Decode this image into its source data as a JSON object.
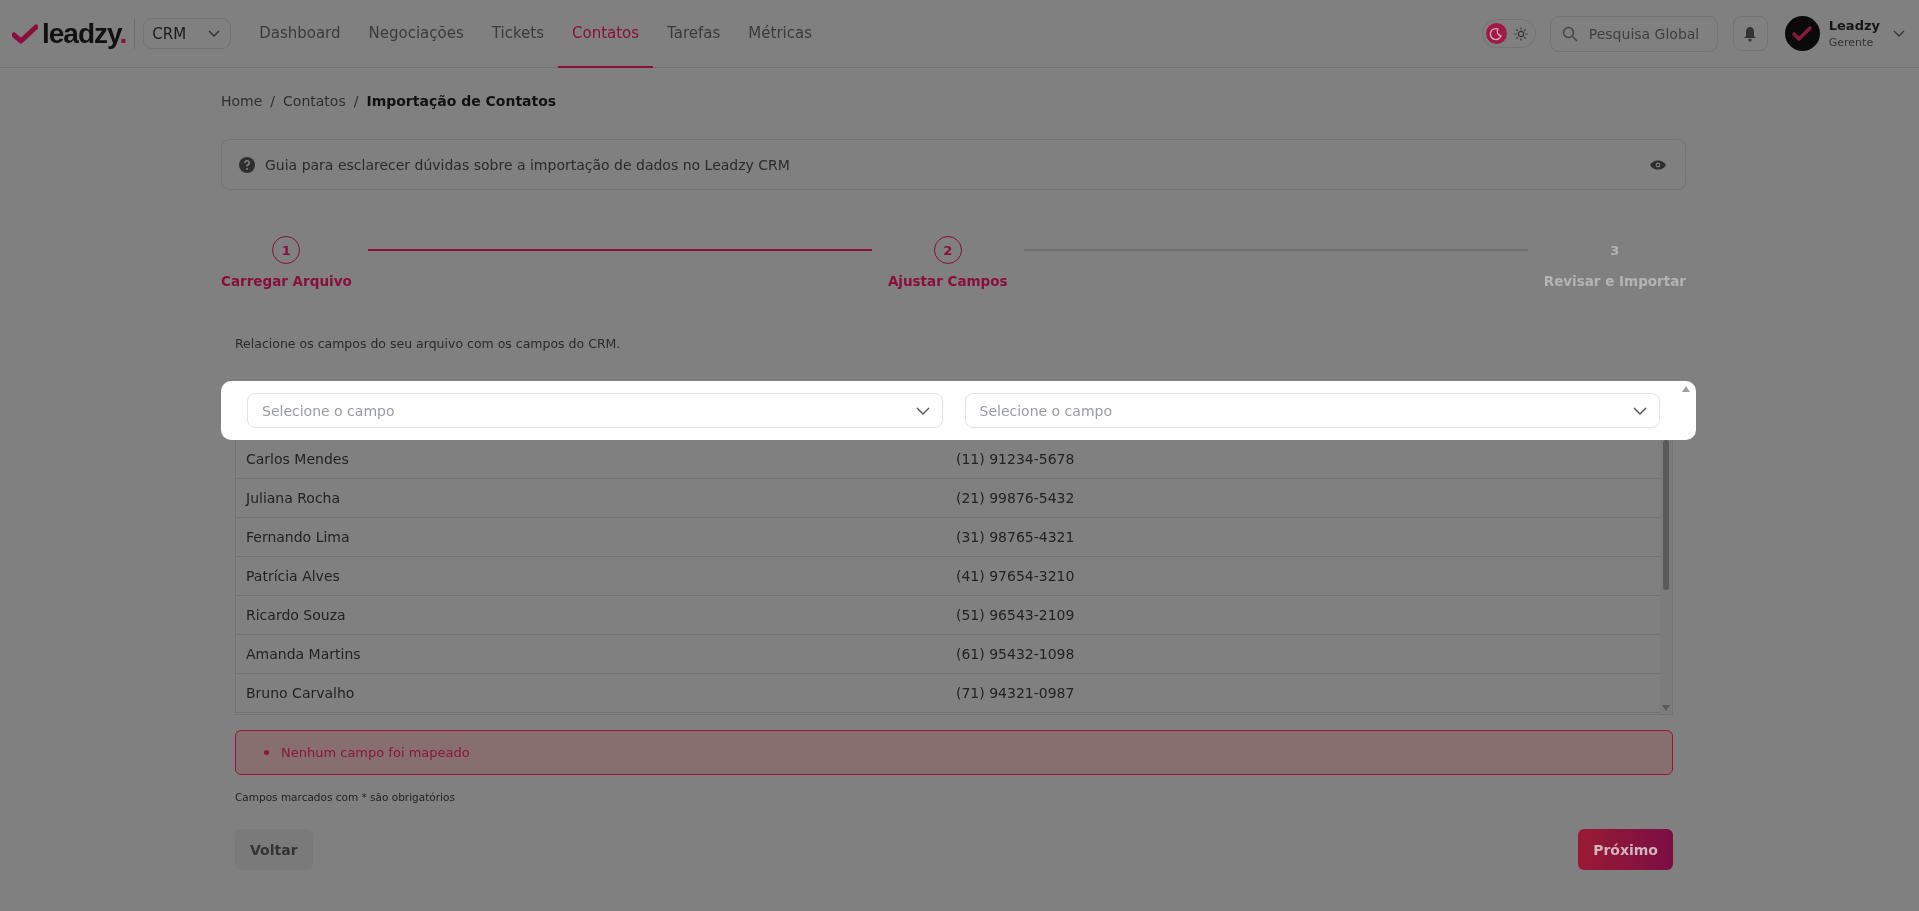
{
  "brand": {
    "word": "leadzy",
    "dot": ".",
    "app_select": "CRM"
  },
  "nav": [
    {
      "label": "Dashboard",
      "selected": false
    },
    {
      "label": "Negociações",
      "selected": false
    },
    {
      "label": "Tickets",
      "selected": false
    },
    {
      "label": "Contatos",
      "selected": true
    },
    {
      "label": "Tarefas",
      "selected": false
    },
    {
      "label": "Métricas",
      "selected": false
    }
  ],
  "theme_options": [
    {
      "kind": "moon",
      "selected": true
    },
    {
      "kind": "sun",
      "selected": false
    }
  ],
  "search": {
    "placeholder": "Pesquisa Global"
  },
  "user": {
    "name": "Leadzy",
    "role": "Gerente"
  },
  "breadcrumb": [
    {
      "kind": "link",
      "label": "Home",
      "current": false
    },
    {
      "kind": "separator",
      "label": "/"
    },
    {
      "kind": "link",
      "label": "Contatos",
      "current": false
    },
    {
      "kind": "separator",
      "label": "/"
    },
    {
      "kind": "link",
      "label": "Importação de Contatos",
      "current": true
    }
  ],
  "guide": {
    "text": "Guia para esclarecer dúvidas sobre a importação de dados no Leadzy CRM"
  },
  "steps": [
    {
      "number": "1",
      "label": "Carregar Arquivo",
      "reached": true
    },
    {
      "number": "2",
      "label": "Ajustar Campos",
      "reached": true
    },
    {
      "number": "3",
      "label": "Revisar e Importar",
      "reached": false
    }
  ],
  "description": "Relacione os campos do seu arquivo com os campos do CRM.",
  "mapping": {
    "columns": [
      {
        "placeholder": "Selecione o campo"
      },
      {
        "placeholder": "Selecione o campo"
      }
    ],
    "rows": [
      [
        "Carlos Mendes",
        "(11) 91234-5678"
      ],
      [
        "Juliana Rocha",
        "(21) 99876-5432"
      ],
      [
        "Fernando Lima",
        "(31) 98765-4321"
      ],
      [
        "Patrícia Alves",
        "(41) 97654-3210"
      ],
      [
        "Ricardo Souza",
        "(51) 96543-2109"
      ],
      [
        "Amanda Martins",
        "(61) 95432-1098"
      ],
      [
        "Bruno Carvalho",
        "(71) 94321-0987"
      ]
    ]
  },
  "errors": [
    "Nenhum campo foi mapeado"
  ],
  "note": "Campos marcados com * são obrigatórios",
  "buttons": {
    "back": "Voltar",
    "next": "Próximo"
  }
}
